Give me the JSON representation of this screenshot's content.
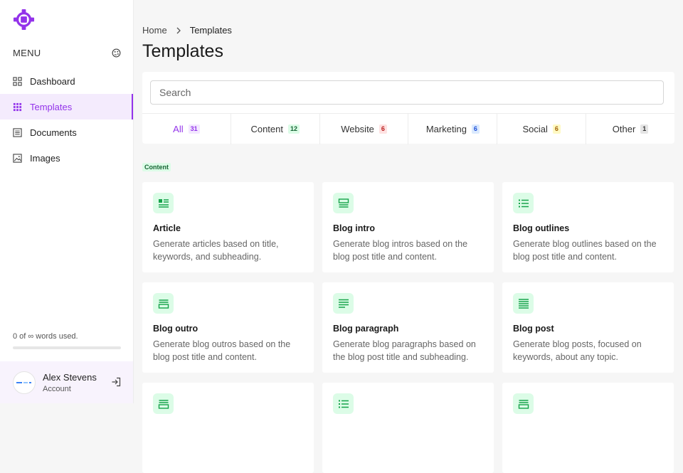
{
  "sidebar": {
    "menu_label": "MENU",
    "items": [
      {
        "label": "Dashboard",
        "icon": "grid-icon"
      },
      {
        "label": "Templates",
        "icon": "dots-grid-icon",
        "active": true
      },
      {
        "label": "Documents",
        "icon": "document-icon"
      },
      {
        "label": "Images",
        "icon": "image-icon"
      }
    ],
    "usage_text": "0 of ∞ words used.",
    "usage_progress": 0,
    "account": {
      "name": "Alex Stevens",
      "subtitle": "Account"
    }
  },
  "breadcrumb": {
    "home": "Home",
    "current": "Templates"
  },
  "page_title": "Templates",
  "search": {
    "placeholder": "Search",
    "value": ""
  },
  "tabs": [
    {
      "label": "All",
      "count": "31",
      "active": true,
      "badge_bg": "#f3e8ff",
      "badge_color": "#9333ea"
    },
    {
      "label": "Content",
      "count": "12",
      "badge_bg": "#dcfce7",
      "badge_color": "#166534"
    },
    {
      "label": "Website",
      "count": "6",
      "badge_bg": "#fee2e2",
      "badge_color": "#b91c1c"
    },
    {
      "label": "Marketing",
      "count": "6",
      "badge_bg": "#dbeafe",
      "badge_color": "#1d4ed8"
    },
    {
      "label": "Social",
      "count": "6",
      "badge_bg": "#fef9c3",
      "badge_color": "#a16207"
    },
    {
      "label": "Other",
      "count": "1",
      "badge_bg": "#e5e5e5",
      "badge_color": "#333333"
    }
  ],
  "section_label": "Content",
  "cards": [
    {
      "title": "Article",
      "desc": "Generate articles based on title, keywords, and subheading.",
      "icon": "article-icon"
    },
    {
      "title": "Blog intro",
      "desc": "Generate blog intros based on the blog post title and content.",
      "icon": "blog-intro-icon"
    },
    {
      "title": "Blog outlines",
      "desc": "Generate blog outlines based on the blog post title and content.",
      "icon": "list-icon"
    },
    {
      "title": "Blog outro",
      "desc": "Generate blog outros based on the blog post title and content.",
      "icon": "blog-outro-icon"
    },
    {
      "title": "Blog paragraph",
      "desc": "Generate blog paragraphs based on the blog post title and subheading.",
      "icon": "paragraph-icon"
    },
    {
      "title": "Blog post",
      "desc": "Generate blog posts, focused on keywords, about any topic.",
      "icon": "blog-post-icon"
    },
    {
      "title": "",
      "desc": "",
      "icon": "blog-outro-icon"
    },
    {
      "title": "",
      "desc": "",
      "icon": "list-icon"
    },
    {
      "title": "",
      "desc": "",
      "icon": "blog-outro-icon"
    }
  ],
  "colors": {
    "accent": "#9333ea",
    "content_green": "#16a34a"
  }
}
